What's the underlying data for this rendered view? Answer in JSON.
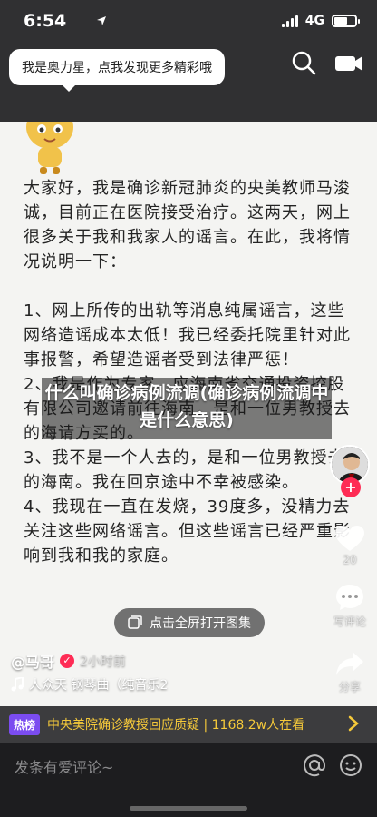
{
  "status": {
    "time": "6:54",
    "network": "4G"
  },
  "top": {
    "tip": "我是奥力星，点我发现更多精彩哦"
  },
  "article": {
    "paragraphs": [
      "大家好，我是确诊新冠肺炎的央美教师马浚诚，目前正在医院接受治疗。这两天，网上很多关于我和我家人的谣言。在此，我将情况说明一下：",
      "1、网上所传的出轨等消息纯属谣言，这些网络造谣成本太低！我已经委托院里针对此事报警，希望造谣者受到法律严惩！\n2、我是作为专家，应海南省交通投资控股有限公司邀请前往海南，是和一位男教授去的海请方买的。\n3、我不是一个人去的，是和一位男教授去的海南。我在回京途中不幸被感染。\n4、我现在一直在发烧，39度多，没精力去关注这些网络谣言。但这些谣言已经严重影响到我和我的家庭。"
    ]
  },
  "overlay": {
    "title": "什么叫确诊病例流调(确诊病例流调中是什么意思)"
  },
  "rail": {
    "like_count": "20",
    "comment_label": "写评论",
    "share_label": "分享"
  },
  "view_all": {
    "label": "点击全屏打开图集"
  },
  "author": {
    "name": "@马哥",
    "time": "2小时前"
  },
  "music": {
    "text": "人众天    钢琴曲（纯音乐2"
  },
  "hot": {
    "tag": "热榜",
    "text": "中央美院确诊教授回应质疑 | 1168.2w人在看"
  },
  "comment": {
    "placeholder": "发条有爱评论~"
  },
  "colors": {
    "accent": "#fe2c55",
    "hot_text": "#f5c93a",
    "hot_tag": "#7b4cf0"
  }
}
